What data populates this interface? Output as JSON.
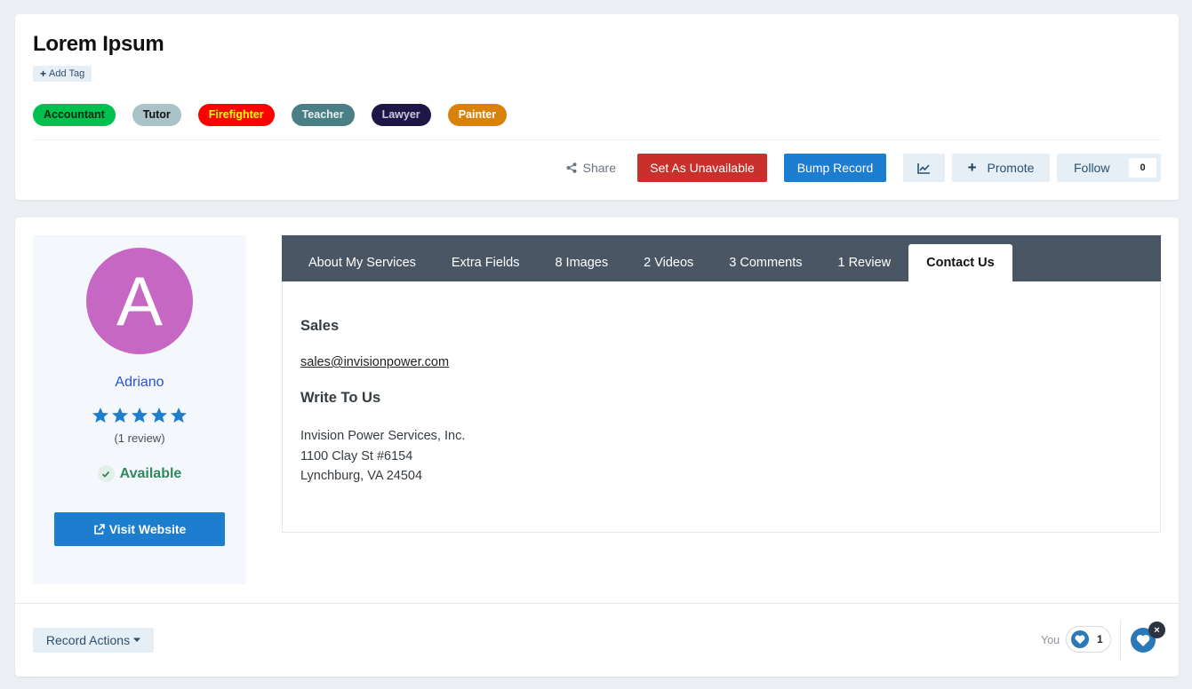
{
  "record": {
    "title": "Lorem Ipsum",
    "add_tag_label": "Add Tag",
    "tags": [
      {
        "label": "Accountant",
        "bg": "#00c050",
        "fg": "#0a2a10"
      },
      {
        "label": "Tutor",
        "bg": "#a9c3c8",
        "fg": "#111111"
      },
      {
        "label": "Firefighter",
        "bg": "#ff0000",
        "fg": "#ffff00"
      },
      {
        "label": "Teacher",
        "bg": "#4a7f86",
        "fg": "#e8f0f2"
      },
      {
        "label": "Lawyer",
        "bg": "#1f1648",
        "fg": "#c8c8dc"
      },
      {
        "label": "Painter",
        "bg": "#d9820b",
        "fg": "#ffffff"
      }
    ]
  },
  "toolbar": {
    "share_label": "Share",
    "unavailable_label": "Set As Unavailable",
    "bump_label": "Bump Record",
    "promote_label": "Promote",
    "follow_label": "Follow",
    "follow_count": "0"
  },
  "profile": {
    "avatar_letter": "A",
    "avatar_color": "#c667c4",
    "author_name": "Adriano",
    "rating": 5,
    "rating_max": 5,
    "review_count_label": "(1 review)",
    "status_label": "Available",
    "visit_label": "Visit Website"
  },
  "tabs": [
    {
      "label": "About My Services",
      "active": false
    },
    {
      "label": "Extra Fields",
      "active": false
    },
    {
      "label": "8 Images",
      "active": false
    },
    {
      "label": "2 Videos",
      "active": false
    },
    {
      "label": "3 Comments",
      "active": false
    },
    {
      "label": "1 Review",
      "active": false
    },
    {
      "label": "Contact Us",
      "active": true
    }
  ],
  "contact": {
    "sales_heading": "Sales",
    "sales_email": "sales@invisionpower.com",
    "write_heading": "Write To Us",
    "address_lines": [
      "Invision Power Services, Inc.",
      "1100 Clay St #6154",
      "Lynchburg, VA 24504"
    ]
  },
  "footer": {
    "record_actions_label": "Record Actions",
    "you_label": "You",
    "reaction_count": "1",
    "close_glyph": "×"
  },
  "colors": {
    "accent_blue": "#1d7dce",
    "danger_red": "#c9302c",
    "star_blue": "#1d7dce",
    "available_green": "#31885e"
  }
}
